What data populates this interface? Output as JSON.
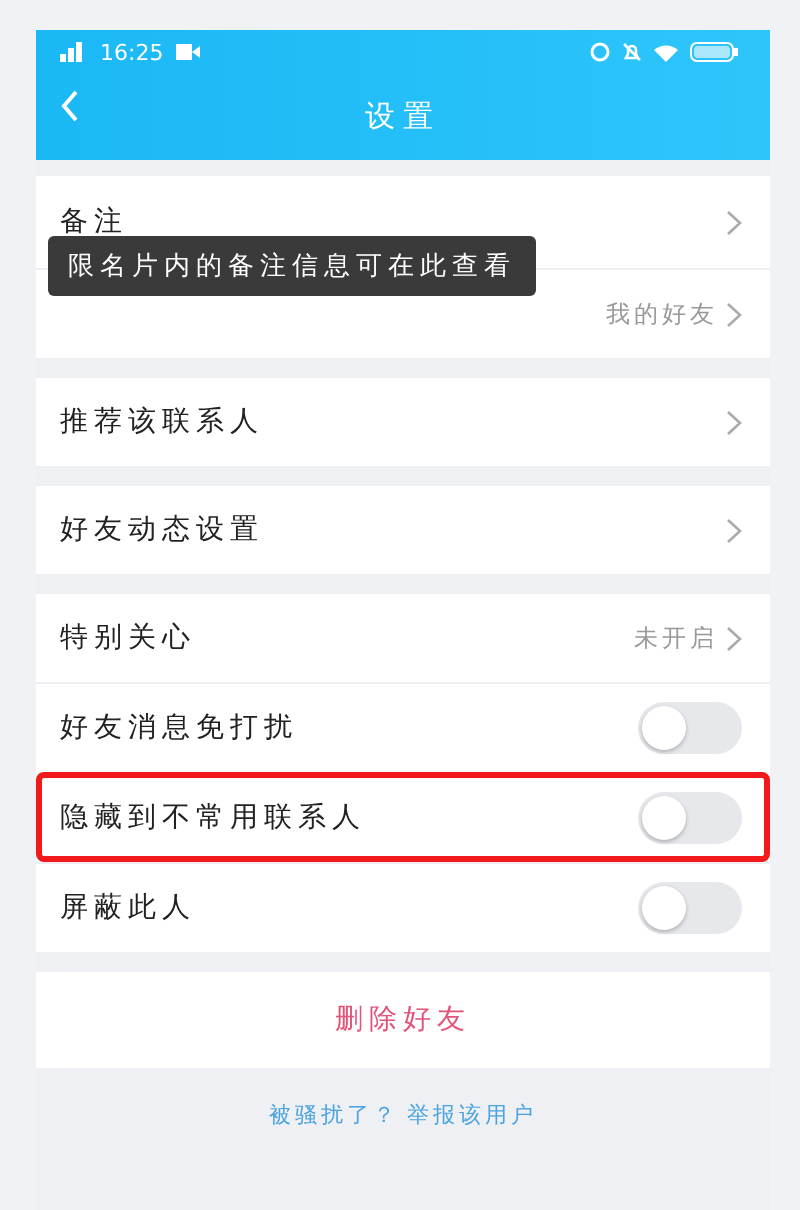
{
  "status_bar": {
    "time": "16:25"
  },
  "header": {
    "title": "设置"
  },
  "tooltip": {
    "text": "限名片内的备注信息可在此查看"
  },
  "sections": [
    {
      "rows": [
        {
          "kind": "link",
          "label": "备注",
          "highlighted": false
        },
        {
          "kind": "link",
          "value": "我的好友",
          "highlighted": false
        }
      ]
    },
    {
      "rows": [
        {
          "kind": "link",
          "label": "推荐该联系人",
          "highlighted": false
        }
      ]
    },
    {
      "rows": [
        {
          "kind": "link",
          "label": "好友动态设置",
          "highlighted": false
        }
      ]
    },
    {
      "rows": [
        {
          "kind": "link",
          "label": "特别关心",
          "value": "未开启",
          "highlighted": false
        },
        {
          "kind": "toggle",
          "label": "好友消息免打扰",
          "on": false,
          "highlighted": false
        },
        {
          "kind": "toggle",
          "label": "隐藏到不常用联系人",
          "on": false,
          "highlighted": true
        },
        {
          "kind": "toggle",
          "label": "屏蔽此人",
          "on": false,
          "highlighted": false
        }
      ]
    }
  ],
  "delete_button": "删除好友",
  "footer": {
    "question": "被骚扰了？",
    "link": "举报该用户"
  }
}
